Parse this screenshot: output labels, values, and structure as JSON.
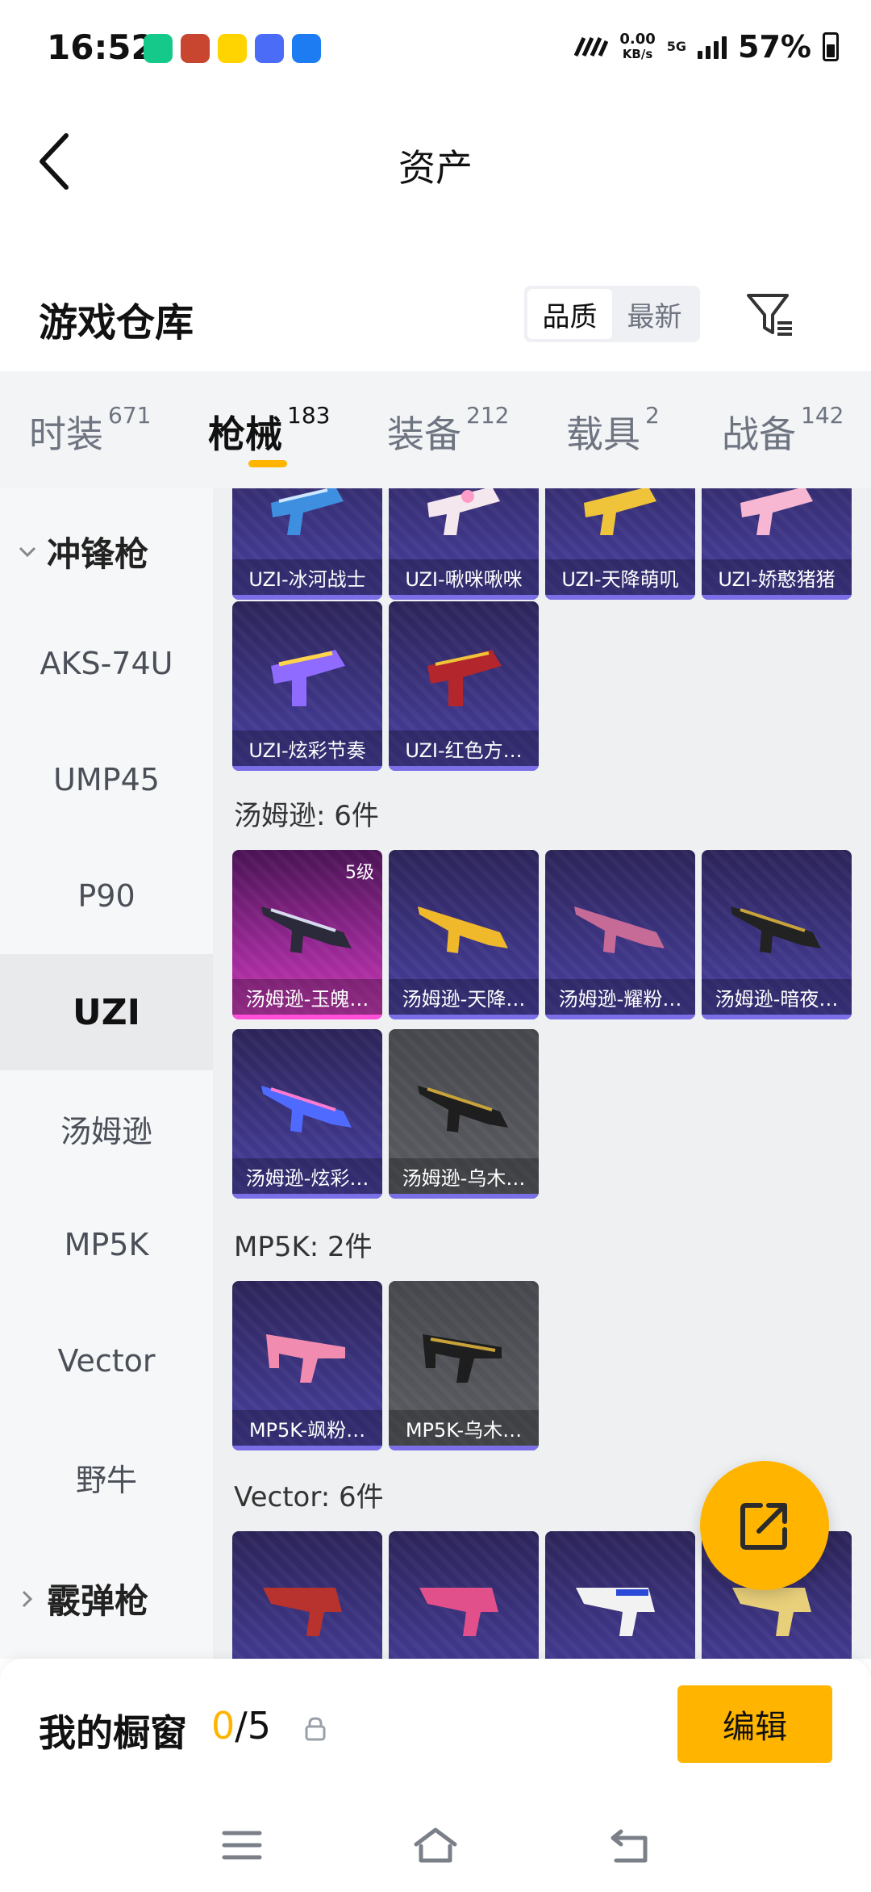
{
  "status_bar": {
    "time": "16:52",
    "net_speed_value": "0.00",
    "net_speed_unit": "KB/s",
    "network": "5G",
    "battery": "57%"
  },
  "header": {
    "title": "资产"
  },
  "warehouse": {
    "title": "游戏仓库",
    "sort_options": [
      "品质",
      "最新"
    ],
    "sort_selected": "品质"
  },
  "tabs": [
    {
      "label": "时装",
      "count": "671"
    },
    {
      "label": "枪械",
      "count": "183",
      "active": true
    },
    {
      "label": "装备",
      "count": "212"
    },
    {
      "label": "载具",
      "count": "2"
    },
    {
      "label": "战备",
      "count": "142"
    }
  ],
  "sidebar": {
    "group_expanded": "冲锋枪",
    "items": [
      "AKS-74U",
      "UMP45",
      "P90",
      "UZI",
      "汤姆逊",
      "MP5K",
      "Vector",
      "野牛"
    ],
    "selected": "UZI",
    "group_collapsed": "霰弹枪"
  },
  "sections": {
    "uzi": {
      "items": [
        "UZI-冰河战士",
        "UZI-啾咪啾咪",
        "UZI-天降萌叽",
        "UZI-娇憨猪猪",
        "UZI-炫彩节奏",
        "UZI-红色方…"
      ]
    },
    "thompson": {
      "title": "汤姆逊: 6件",
      "items": [
        "汤姆逊-玉魄…",
        "汤姆逊-天降…",
        "汤姆逊-耀粉…",
        "汤姆逊-暗夜…",
        "汤姆逊-炫彩…",
        "汤姆逊-乌木…"
      ],
      "first_level": "5级"
    },
    "mp5k": {
      "title": "MP5K: 2件",
      "items": [
        "MP5K-飒粉…",
        "MP5K-乌木…"
      ]
    },
    "vector": {
      "title": "Vector: 6件"
    }
  },
  "showcase": {
    "title": "我的橱窗",
    "current": "0",
    "total": "/5",
    "edit_label": "编辑"
  },
  "colors": {
    "accent": "#ffb400",
    "card_purple": "#3d3584",
    "card_pink": "#9a2896",
    "card_gray": "#5c5e63"
  }
}
